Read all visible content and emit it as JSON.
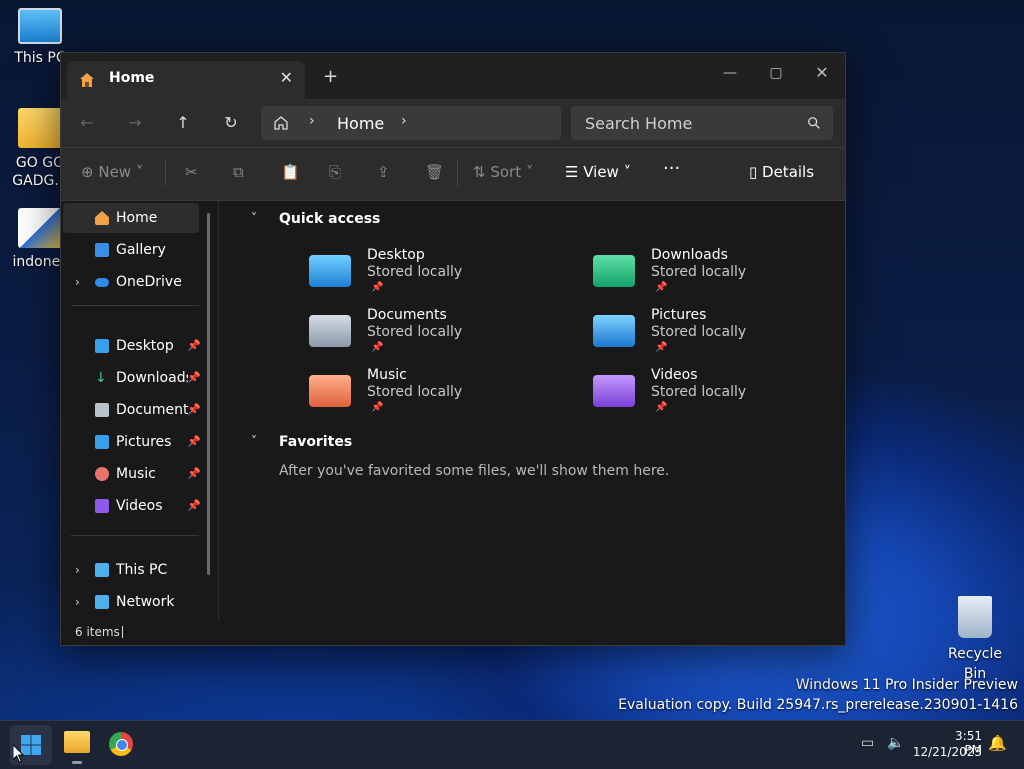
{
  "desktop": {
    "icons": [
      {
        "label": "This PC"
      },
      {
        "label": "GO GO GADG..."
      },
      {
        "label": "indones"
      },
      {
        "label": "Recycle Bin"
      }
    ],
    "watermark_line1": "Windows 11 Pro Insider Preview",
    "watermark_line2": "Evaluation copy. Build 25947.rs_prerelease.230901-1416"
  },
  "window": {
    "tab_title": "Home",
    "address_crumb": "Home",
    "search_placeholder": "Search Home",
    "toolbar": {
      "new_label": "New",
      "sort_label": "Sort",
      "view_label": "View",
      "more_label": "···",
      "details_label": "Details"
    },
    "sidebar": {
      "home": "Home",
      "gallery": "Gallery",
      "onedrive": "OneDrive",
      "desktop": "Desktop",
      "downloads": "Downloads",
      "documents": "Documents",
      "pictures": "Pictures",
      "music": "Music",
      "videos": "Videos",
      "thispc": "This PC",
      "network": "Network"
    },
    "sections": {
      "quick_access": "Quick access",
      "favorites": "Favorites",
      "favorites_empty": "After you've favorited some files, we'll show them here."
    },
    "quick_access": [
      {
        "name": "Desktop",
        "status": "Stored locally"
      },
      {
        "name": "Downloads",
        "status": "Stored locally"
      },
      {
        "name": "Documents",
        "status": "Stored locally"
      },
      {
        "name": "Pictures",
        "status": "Stored locally"
      },
      {
        "name": "Music",
        "status": "Stored locally"
      },
      {
        "name": "Videos",
        "status": "Stored locally"
      }
    ],
    "status_count": "6 items"
  },
  "taskbar": {
    "time": "3:51 PM",
    "date": "12/21/2023"
  },
  "colors": {
    "accent": "#4aa3f0",
    "sidebar_selected": "#2d2d2d"
  }
}
